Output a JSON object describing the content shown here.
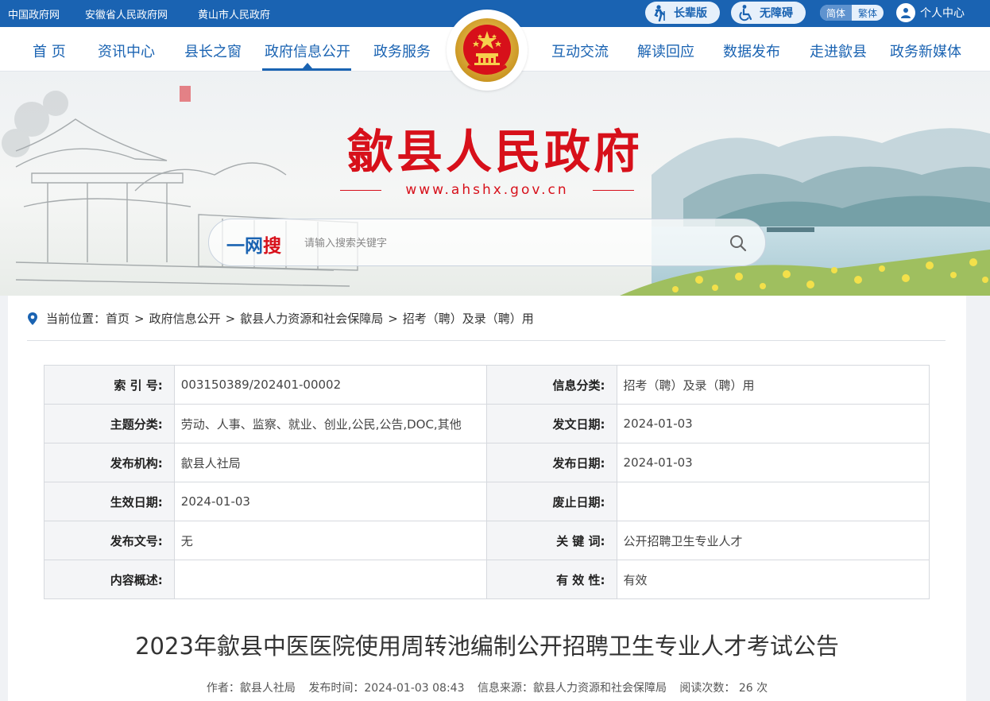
{
  "topbar": {
    "links": [
      "中国政府网",
      "安徽省人民政府网",
      "黄山市人民政府"
    ],
    "elder_label": "长辈版",
    "accessible_label": "无障碍",
    "lang_simplified": "简体",
    "lang_traditional": "繁体",
    "user_label": "个人中心"
  },
  "nav": {
    "left": [
      "首 页",
      "资讯中心",
      "县长之窗",
      "政府信息公开",
      "政务服务"
    ],
    "right": [
      "互动交流",
      "解读回应",
      "数据发布",
      "走进歙县",
      "政务新媒体"
    ],
    "active": "政府信息公开"
  },
  "banner": {
    "title": "歙县人民政府",
    "url": "www.ahshx.gov.cn",
    "search_brand_a": "一网",
    "search_brand_b": "搜",
    "search_placeholder": "请输入搜索关键字"
  },
  "breadcrumb": {
    "prefix": "当前位置：",
    "items": [
      "首页",
      "政府信息公开",
      "歙县人力资源和社会保障局",
      "招考（聘）及录（聘）用"
    ],
    "sep": ">"
  },
  "meta_table": {
    "rows": [
      {
        "k1": "索 引 号:",
        "v1": "003150389/202401-00002",
        "k2": "信息分类:",
        "v2": "招考（聘）及录（聘）用"
      },
      {
        "k1": "主题分类:",
        "v1": "劳动、人事、监察、就业、创业,公民,公告,DOC,其他",
        "k2": "发文日期:",
        "v2": "2024-01-03"
      },
      {
        "k1": "发布机构:",
        "v1": "歙县人社局",
        "k2": "发布日期:",
        "v2": "2024-01-03"
      },
      {
        "k1": "生效日期:",
        "v1": "2024-01-03",
        "k2": "废止日期:",
        "v2": ""
      },
      {
        "k1": "发布文号:",
        "v1": "无",
        "k2": "关 键 词:",
        "v2": "公开招聘卫生专业人才"
      },
      {
        "k1": "内容概述:",
        "v1": "",
        "k2": "有 效 性:",
        "v2": "有效"
      }
    ]
  },
  "article": {
    "title": "2023年歙县中医医院使用周转池编制公开招聘卫生专业人才考试公告",
    "author": "作者：歙县人社局",
    "published": "发布时间：2024-01-03 08:43",
    "source": "信息来源：歙县人力资源和社会保障局",
    "views": "阅读次数： 26 次"
  },
  "colors": {
    "primary": "#1a63b2",
    "accent_red": "#d7101a"
  },
  "icons": [
    "elder-icon",
    "wheelchair-icon",
    "user-icon",
    "national-emblem-icon",
    "search-icon",
    "location-pin-icon"
  ]
}
